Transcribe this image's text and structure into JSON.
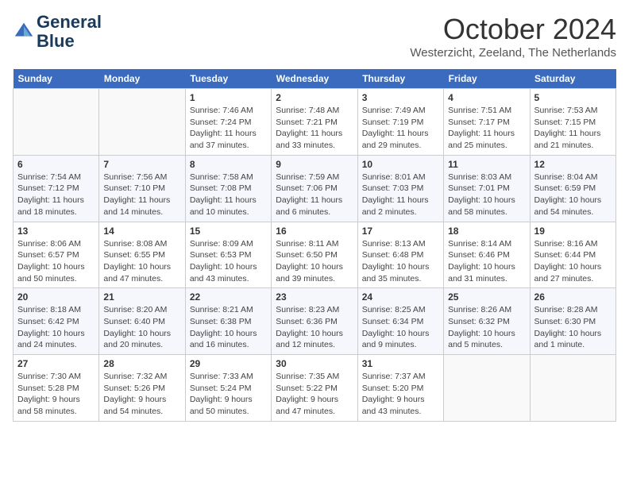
{
  "header": {
    "logo_line1": "General",
    "logo_line2": "Blue",
    "month_year": "October 2024",
    "location": "Westerzicht, Zeeland, The Netherlands"
  },
  "weekdays": [
    "Sunday",
    "Monday",
    "Tuesday",
    "Wednesday",
    "Thursday",
    "Friday",
    "Saturday"
  ],
  "days": [
    {
      "num": "",
      "info": ""
    },
    {
      "num": "",
      "info": ""
    },
    {
      "num": "1",
      "info": "Sunrise: 7:46 AM\nSunset: 7:24 PM\nDaylight: 11 hours\nand 37 minutes."
    },
    {
      "num": "2",
      "info": "Sunrise: 7:48 AM\nSunset: 7:21 PM\nDaylight: 11 hours\nand 33 minutes."
    },
    {
      "num": "3",
      "info": "Sunrise: 7:49 AM\nSunset: 7:19 PM\nDaylight: 11 hours\nand 29 minutes."
    },
    {
      "num": "4",
      "info": "Sunrise: 7:51 AM\nSunset: 7:17 PM\nDaylight: 11 hours\nand 25 minutes."
    },
    {
      "num": "5",
      "info": "Sunrise: 7:53 AM\nSunset: 7:15 PM\nDaylight: 11 hours\nand 21 minutes."
    },
    {
      "num": "6",
      "info": "Sunrise: 7:54 AM\nSunset: 7:12 PM\nDaylight: 11 hours\nand 18 minutes."
    },
    {
      "num": "7",
      "info": "Sunrise: 7:56 AM\nSunset: 7:10 PM\nDaylight: 11 hours\nand 14 minutes."
    },
    {
      "num": "8",
      "info": "Sunrise: 7:58 AM\nSunset: 7:08 PM\nDaylight: 11 hours\nand 10 minutes."
    },
    {
      "num": "9",
      "info": "Sunrise: 7:59 AM\nSunset: 7:06 PM\nDaylight: 11 hours\nand 6 minutes."
    },
    {
      "num": "10",
      "info": "Sunrise: 8:01 AM\nSunset: 7:03 PM\nDaylight: 11 hours\nand 2 minutes."
    },
    {
      "num": "11",
      "info": "Sunrise: 8:03 AM\nSunset: 7:01 PM\nDaylight: 10 hours\nand 58 minutes."
    },
    {
      "num": "12",
      "info": "Sunrise: 8:04 AM\nSunset: 6:59 PM\nDaylight: 10 hours\nand 54 minutes."
    },
    {
      "num": "13",
      "info": "Sunrise: 8:06 AM\nSunset: 6:57 PM\nDaylight: 10 hours\nand 50 minutes."
    },
    {
      "num": "14",
      "info": "Sunrise: 8:08 AM\nSunset: 6:55 PM\nDaylight: 10 hours\nand 47 minutes."
    },
    {
      "num": "15",
      "info": "Sunrise: 8:09 AM\nSunset: 6:53 PM\nDaylight: 10 hours\nand 43 minutes."
    },
    {
      "num": "16",
      "info": "Sunrise: 8:11 AM\nSunset: 6:50 PM\nDaylight: 10 hours\nand 39 minutes."
    },
    {
      "num": "17",
      "info": "Sunrise: 8:13 AM\nSunset: 6:48 PM\nDaylight: 10 hours\nand 35 minutes."
    },
    {
      "num": "18",
      "info": "Sunrise: 8:14 AM\nSunset: 6:46 PM\nDaylight: 10 hours\nand 31 minutes."
    },
    {
      "num": "19",
      "info": "Sunrise: 8:16 AM\nSunset: 6:44 PM\nDaylight: 10 hours\nand 27 minutes."
    },
    {
      "num": "20",
      "info": "Sunrise: 8:18 AM\nSunset: 6:42 PM\nDaylight: 10 hours\nand 24 minutes."
    },
    {
      "num": "21",
      "info": "Sunrise: 8:20 AM\nSunset: 6:40 PM\nDaylight: 10 hours\nand 20 minutes."
    },
    {
      "num": "22",
      "info": "Sunrise: 8:21 AM\nSunset: 6:38 PM\nDaylight: 10 hours\nand 16 minutes."
    },
    {
      "num": "23",
      "info": "Sunrise: 8:23 AM\nSunset: 6:36 PM\nDaylight: 10 hours\nand 12 minutes."
    },
    {
      "num": "24",
      "info": "Sunrise: 8:25 AM\nSunset: 6:34 PM\nDaylight: 10 hours\nand 9 minutes."
    },
    {
      "num": "25",
      "info": "Sunrise: 8:26 AM\nSunset: 6:32 PM\nDaylight: 10 hours\nand 5 minutes."
    },
    {
      "num": "26",
      "info": "Sunrise: 8:28 AM\nSunset: 6:30 PM\nDaylight: 10 hours\nand 1 minute."
    },
    {
      "num": "27",
      "info": "Sunrise: 7:30 AM\nSunset: 5:28 PM\nDaylight: 9 hours\nand 58 minutes."
    },
    {
      "num": "28",
      "info": "Sunrise: 7:32 AM\nSunset: 5:26 PM\nDaylight: 9 hours\nand 54 minutes."
    },
    {
      "num": "29",
      "info": "Sunrise: 7:33 AM\nSunset: 5:24 PM\nDaylight: 9 hours\nand 50 minutes."
    },
    {
      "num": "30",
      "info": "Sunrise: 7:35 AM\nSunset: 5:22 PM\nDaylight: 9 hours\nand 47 minutes."
    },
    {
      "num": "31",
      "info": "Sunrise: 7:37 AM\nSunset: 5:20 PM\nDaylight: 9 hours\nand 43 minutes."
    },
    {
      "num": "",
      "info": ""
    },
    {
      "num": "",
      "info": ""
    }
  ]
}
